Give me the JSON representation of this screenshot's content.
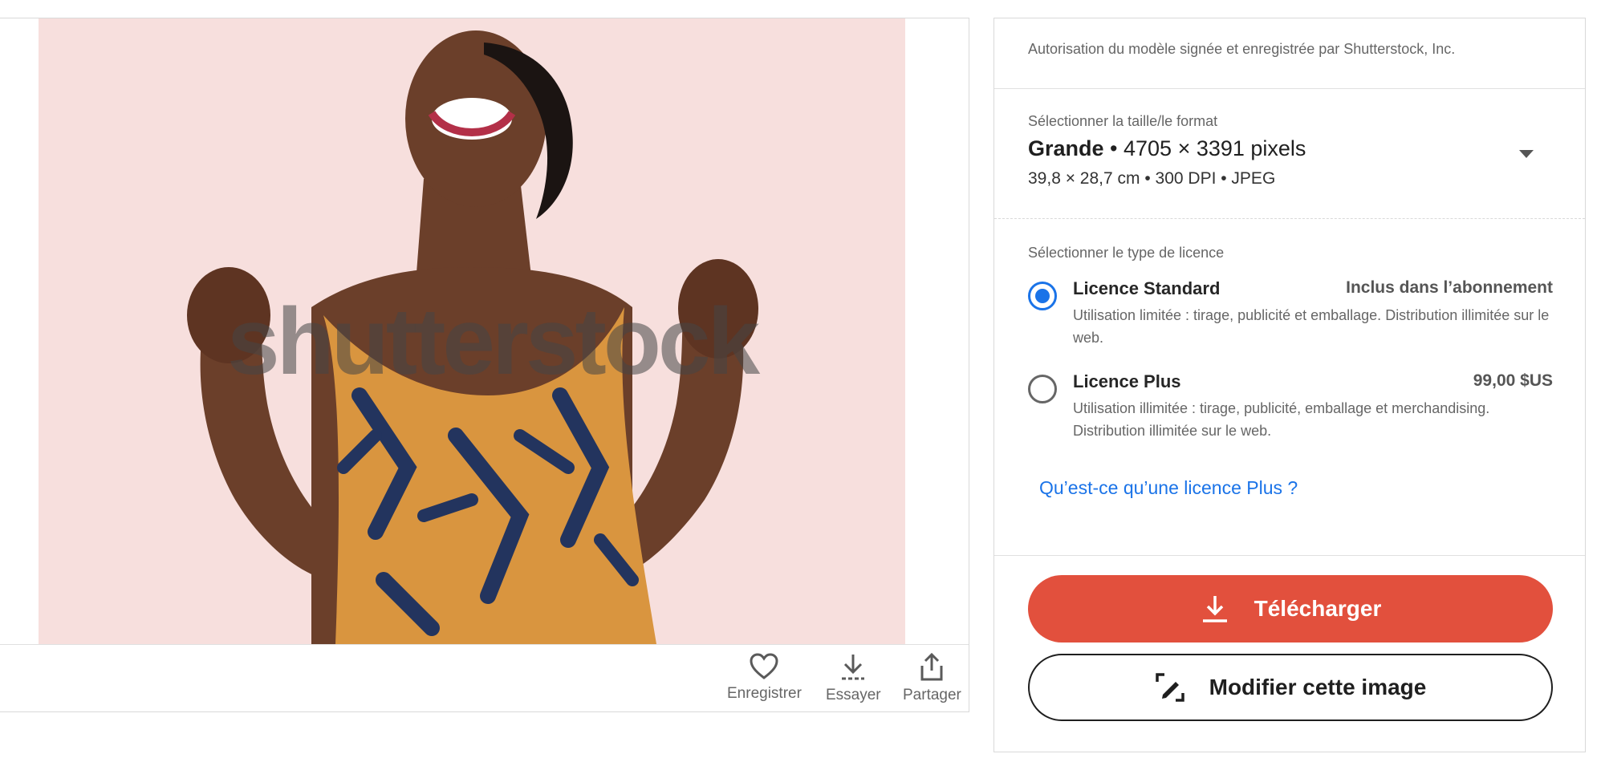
{
  "image": {
    "watermark": "shutterstock",
    "alt": ""
  },
  "actions": [
    {
      "label": "Enregistrer",
      "icon": "heart-icon"
    },
    {
      "label": "Essayer",
      "icon": "download-icon"
    },
    {
      "label": "Partager",
      "icon": "share-icon"
    }
  ],
  "panel": {
    "model_release": "Autorisation du modèle signée et enregistrée par Shutterstock, Inc.",
    "size": {
      "label": "Sélectionner la taille/le format",
      "name": "Grande",
      "separator": " • ",
      "pixels": "4705 × 3391 pixels",
      "details": "39,8 × 28,7 cm • 300 DPI • JPEG"
    },
    "license": {
      "label": "Sélectionner le type de licence",
      "options": [
        {
          "title": "Licence Standard",
          "price": "Inclus dans l’abonnement",
          "description": "Utilisation limitée : tirage, publicité et emballage. Distribution illimitée sur le web.",
          "selected": true
        },
        {
          "title": "Licence Plus",
          "price": "99,00 $US",
          "description": "Utilisation illimitée : tirage, publicité, emballage et merchandising. Distribution illimitée sur le web.",
          "selected": false
        }
      ],
      "plus_link": "Qu’est-ce qu’une licence Plus ?"
    },
    "download_button": "Télécharger",
    "edit_button": "Modifier cette image"
  },
  "colors": {
    "primary": "#e2503d",
    "link": "#1a73e8",
    "image_background": "#f7dfdd"
  }
}
